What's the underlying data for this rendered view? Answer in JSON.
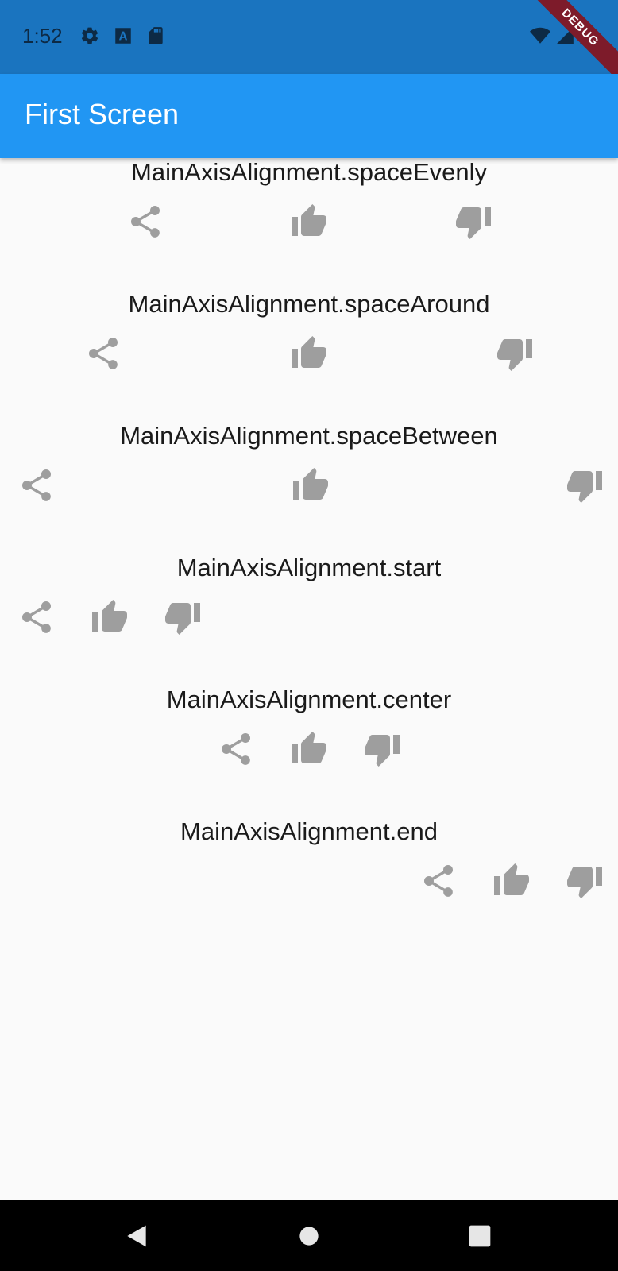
{
  "status_bar": {
    "time": "1:52",
    "debug_label": "DEBUG",
    "icons": [
      "settings-icon",
      "a-icon",
      "sd-card-icon",
      "wifi-icon",
      "signal-icon",
      "battery-icon"
    ],
    "color": "#1a74bf"
  },
  "app_bar": {
    "title": "First Screen",
    "color": "#2196f3"
  },
  "sections": [
    {
      "label": "MainAxisAlignment.spaceEvenly",
      "icons": [
        "share-icon",
        "thumb-up-icon",
        "thumb-down-icon"
      ]
    },
    {
      "label": "MainAxisAlignment.spaceAround",
      "icons": [
        "share-icon",
        "thumb-up-icon",
        "thumb-down-icon"
      ]
    },
    {
      "label": "MainAxisAlignment.spaceBetween",
      "icons": [
        "share-icon",
        "thumb-up-icon",
        "thumb-down-icon"
      ]
    },
    {
      "label": "MainAxisAlignment.start",
      "icons": [
        "share-icon",
        "thumb-up-icon",
        "thumb-down-icon"
      ]
    },
    {
      "label": "MainAxisAlignment.center",
      "icons": [
        "share-icon",
        "thumb-up-icon",
        "thumb-down-icon"
      ]
    },
    {
      "label": "MainAxisAlignment.end",
      "icons": [
        "share-icon",
        "thumb-up-icon",
        "thumb-down-icon"
      ]
    }
  ],
  "nav_bar": {
    "buttons": [
      "back-icon",
      "home-icon",
      "recents-icon"
    ]
  },
  "icon_color": "#9e9e9e"
}
